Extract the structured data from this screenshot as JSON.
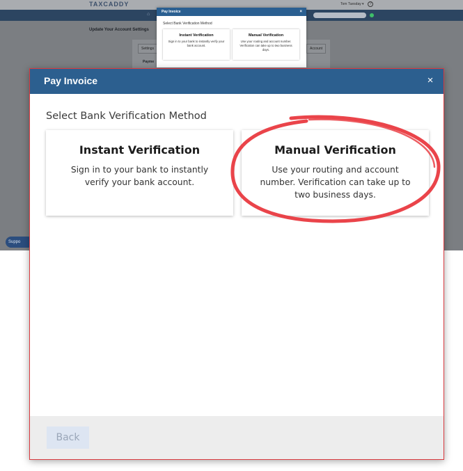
{
  "background_app": {
    "logo": "TAXCADDY",
    "user_name": "Tom Tuesday",
    "user_caret": "▾",
    "help_glyph": "?",
    "home_glyph": "⌂",
    "page_heading": "Update Your Account Settings",
    "card_buttons": [
      "Settings",
      "Account"
    ],
    "payment_label": "Payme",
    "support_label": "Suppo",
    "search_placeholder": "",
    "status_color": "#3fbf6a"
  },
  "modal": {
    "title": "Pay Invoice",
    "close_glyph": "×",
    "subtitle": "Select Bank Verification Method",
    "options": [
      {
        "title": "Instant Verification",
        "description": "Sign in to your bank to instantly verify your bank account."
      },
      {
        "title": "Manual Verification",
        "description": "Use your routing and account number. Verification can take up to two business days."
      }
    ],
    "back_label": "Back"
  },
  "colors": {
    "header": "#2c5f8f",
    "highlight_ring": "#e8343b",
    "modal_border": "#d93a3f",
    "back_button_bg": "#dde5f2"
  }
}
